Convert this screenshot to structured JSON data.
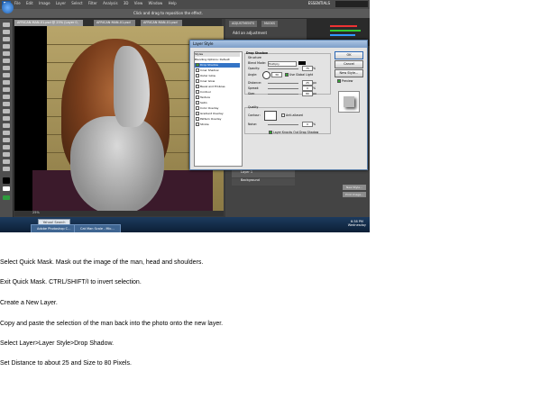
{
  "app": {
    "logo": "Ps",
    "menus": [
      "File",
      "Edit",
      "Image",
      "Layer",
      "Select",
      "Filter",
      "Analysis",
      "3D",
      "View",
      "Window",
      "Help"
    ],
    "workspace": "ESSENTIALS",
    "options_hint": "Click and drag to reposition the effect."
  },
  "document_tabs": [
    "AFRICAN MAN-01.psd @ 25% (Layer 0, RGB/8) *",
    "AFRICAN MAN-01.psd",
    "AFRICAN MAN-01.psd"
  ],
  "panels": {
    "tabs": [
      "ADJUSTMENTS",
      "MASKS"
    ],
    "adjustments_title": "Add an adjustment",
    "layers": [
      {
        "name": "Drop Shadow"
      },
      {
        "name": "Layer 1"
      },
      {
        "name": "Background"
      }
    ],
    "side_buttons": [
      "New Style...",
      "Print Image..."
    ]
  },
  "layer_style_dialog": {
    "title": "Layer Style",
    "styles_header": "Styles",
    "styles": [
      {
        "label": "Blending Options: Default",
        "checkbox": false,
        "selected": false
      },
      {
        "label": "Drop Shadow",
        "checkbox": true,
        "checked": true,
        "selected": true
      },
      {
        "label": "Inner Shadow",
        "checkbox": true,
        "checked": false,
        "selected": false
      },
      {
        "label": "Outer Glow",
        "checkbox": true,
        "checked": false,
        "selected": false
      },
      {
        "label": "Inner Glow",
        "checkbox": true,
        "checked": false,
        "selected": false
      },
      {
        "label": "Bevel and Emboss",
        "checkbox": true,
        "checked": false,
        "selected": false
      },
      {
        "label": "Contour",
        "checkbox": true,
        "checked": false,
        "selected": false
      },
      {
        "label": "Texture",
        "checkbox": true,
        "checked": false,
        "selected": false
      },
      {
        "label": "Satin",
        "checkbox": true,
        "checked": false,
        "selected": false
      },
      {
        "label": "Color Overlay",
        "checkbox": true,
        "checked": false,
        "selected": false
      },
      {
        "label": "Gradient Overlay",
        "checkbox": true,
        "checked": false,
        "selected": false
      },
      {
        "label": "Pattern Overlay",
        "checkbox": true,
        "checked": false,
        "selected": false
      },
      {
        "label": "Stroke",
        "checkbox": true,
        "checked": false,
        "selected": false
      }
    ],
    "drop_shadow": {
      "section": "Drop Shadow",
      "structure": "Structure",
      "blend_mode_label": "Blend Mode:",
      "blend_mode": "Multiply",
      "opacity_label": "Opacity:",
      "opacity": "75",
      "angle_label": "Angle:",
      "angle": "30",
      "global_light": "Use Global Light",
      "distance_label": "Distance:",
      "distance": "25",
      "spread_label": "Spread:",
      "spread": "0",
      "size_label": "Size:",
      "size": "80",
      "unit_px": "px",
      "unit_pct": "%",
      "quality": "Quality",
      "contour_label": "Contour:",
      "anti_aliased": "Anti-aliased",
      "noise_label": "Noise:",
      "noise": "0",
      "knockout": "Layer Knocks Out Drop Shadow"
    },
    "buttons": {
      "ok": "OK",
      "cancel": "Cancel",
      "new_style": "New Style...",
      "preview": "Preview"
    }
  },
  "status_bar": {
    "zoom": "25%"
  },
  "taskbar": {
    "search": "Yahoo! Search",
    "tasks": [
      "Adobe Photoshop C...",
      "Cat Man Scale - Mic..."
    ],
    "time": "6:38 PM",
    "day": "Wednesday"
  },
  "instructions": [
    "Select Quick Mask. Mask out the image of the man, head and shoulders.",
    "Exit Quick Mask. CTRL/SHIFT/I to invert selection.",
    "Create a New Layer.",
    "Copy and paste the selection of the man back into the photo onto the new layer.",
    "Select Layer>Layer Style>Drop Shadow.",
    "Set Distance to about 25 and Size to 80 Pixels."
  ]
}
